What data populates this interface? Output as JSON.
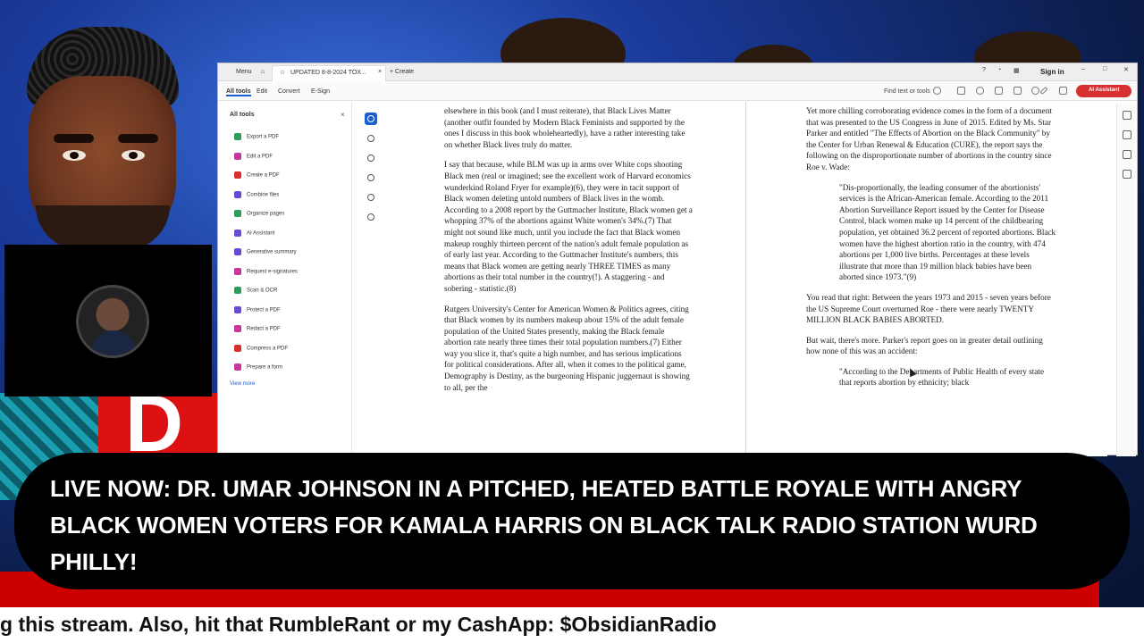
{
  "window": {
    "menu_label": "Menu",
    "tab_title": "UPDATED 8-8-2024 TOX...",
    "new_tab_label": "Create",
    "sign_in": "Sign in"
  },
  "menubar": {
    "items": [
      "All tools",
      "Edit",
      "Convert",
      "E-Sign"
    ],
    "find_text": "Find text or tools",
    "ai_assistant": "AI Assistant"
  },
  "sidebar": {
    "title": "All tools",
    "close": "×",
    "items": [
      {
        "label": "Export a PDF",
        "color": "#2e9d5b"
      },
      {
        "label": "Edit a PDF",
        "color": "#c5379c"
      },
      {
        "label": "Create a PDF",
        "color": "#d63030"
      },
      {
        "label": "Combine files",
        "color": "#6a4bd0"
      },
      {
        "label": "Organize pages",
        "color": "#2e9d5b"
      },
      {
        "label": "AI Assistant",
        "color": "#6a4bd0"
      },
      {
        "label": "Generative summary",
        "color": "#6a4bd0"
      },
      {
        "label": "Request e-signatures",
        "color": "#c5379c"
      },
      {
        "label": "Scan & OCR",
        "color": "#2e9d5b"
      },
      {
        "label": "Protect a PDF",
        "color": "#6a4bd0"
      },
      {
        "label": "Redact a PDF",
        "color": "#c5379c"
      },
      {
        "label": "Compress a PDF",
        "color": "#d63030"
      },
      {
        "label": "Prepare a form",
        "color": "#c5379c"
      }
    ],
    "view_more": "View more"
  },
  "document": {
    "left_column": [
      "elsewhere in this book (and I must reiterate), that Black Lives Matter (another outfit founded by Modern Black Feminists and supported by the ones I discuss in this book wholeheartedly), have a rather interesting take on whether Black lives truly do matter.",
      "I say that because, while BLM was up in arms over White cops shooting Black men (real or imagined; see the excellent work of Harvard economics wunderkind Roland Fryer for example)(6), they were in tacit support of Black women deleting untold numbers of Black lives in the womb. According to a 2008 report by the Guttmacher Institute, Black women get a whopping 37% of the abortions against White women's 34%.(7) That might not sound like much, until you include the fact that Black women makeup roughly thirteen percent of the nation's adult female population as of early last year. According to the Guttmacher Institute's numbers, this means that Black women are getting nearly THREE TIMES as many abortions as their total number in the country(!). A staggering - and sobering - statistic.(8)",
      "Rutgers University's Center for American Women & Politics agrees, citing that Black women by its numbers makeup about 15% of the adult female population of the United States presently, making the Black female abortion rate nearly three times their total population numbers.(7) Either way you slice it, that's quite a high number, and has serious implications for political considerations. After all, when it comes to the political game, Demography is Destiny, as the burgeoning Hispanic juggernaut is showing to all, per the"
    ],
    "right_column": [
      "Yet more chilling corroborating evidence comes in the form of a document that was presented to the US Congress in June of 2015. Edited by Ms. Star Parker and entitled \"The Effects of Abortion on the Black Community\" by the Center for Urban Renewal & Education (CURE), the report says the following on the disproportionate number of abortions in the country since Roe v. Wade:",
      "\"Dis-proportionally, the leading consumer of the abortionists' services is the African-American female. According to the 2011 Abortion Surveillance Report issued by the Center for Disease Control, black women make up 14 percent of the childbearing population, yet obtained 36.2 percent of reported abortions. Black women have the highest abortion ratio in the country, with 474 abortions per 1,000 live births. Percentages at these levels illustrate that more than 19 million black babies have been aborted since 1973.\"(9)",
      "You read that right: Between the years 1973 and 2015 - seven years before the US Supreme Court overturned Roe - there were nearly TWENTY MILLION BLACK BABIES ABORTED.",
      "But wait, there's more. Parker's report goes on in greater detail outlining how none of this was an accident:",
      "\"According to the Departments of Public Health of every state that reports abortion by ethnicity; black"
    ]
  },
  "banner": {
    "text": "LIVE NOW: DR. UMAR JOHNSON IN A PITCHED, HEATED BATTLE ROYALE WITH ANGRY BLACK WOMEN VOTERS FOR KAMALA HARRIS ON BLACK TALK RADIO STATION WURD PHILLY!"
  },
  "ticker": {
    "text": "g this stream. Also, hit that RumbleRant or my CashApp: $ObsidianRadio"
  },
  "background": {
    "red_letter": "D"
  }
}
